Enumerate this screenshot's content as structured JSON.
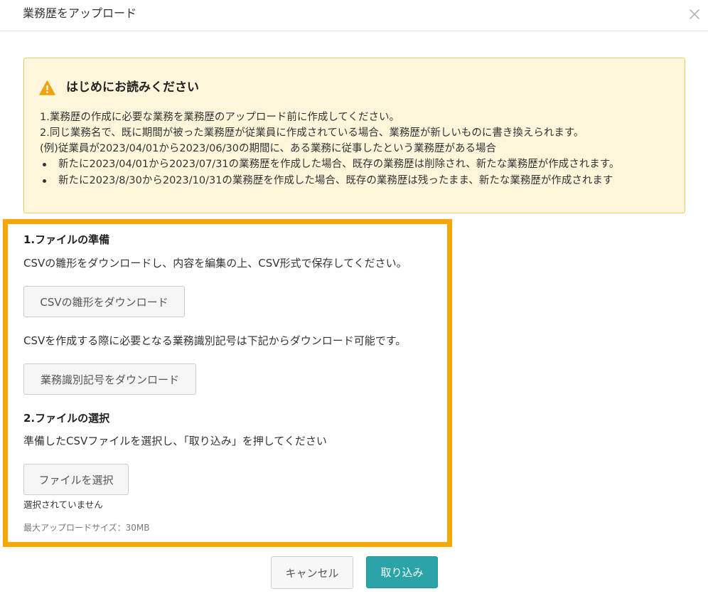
{
  "dialog": {
    "title": "業務歴をアップロード"
  },
  "notice": {
    "title": "はじめにお読みください",
    "lines": [
      "1.業務歴の作成に必要な業務を業務歴のアップロード前に作成してください。",
      "2.同じ業務名で、既に期間が被った業務歴が従業員に作成されている場合、業務歴が新しいものに書き換えられます。",
      "(例)従業員が2023/04/01から2023/06/30の期間に、ある業務に従事したという業務歴がある場合"
    ],
    "bullets": [
      "新たに2023/04/01から2023/07/31の業務歴を作成した場合、既存の業務歴は削除され、新たな業務歴が作成されます。",
      "新たに2023/8/30から2023/10/31の業務歴を作成した場合、既存の業務歴は残ったまま、新たな業務歴が作成されます"
    ]
  },
  "prepare": {
    "title": "1.ファイルの準備",
    "description": "CSVの雛形をダウンロードし、内容を編集の上、CSV形式で保存してください。",
    "template_button": "CSVの雛形をダウンロード",
    "id_description": "CSVを作成する際に必要となる業務識別記号は下記からダウンロード可能です。",
    "id_button": "業務識別記号をダウンロード"
  },
  "select": {
    "title": "2.ファイルの選択",
    "description": "準備したCSVファイルを選択し、「取り込み」を押してください",
    "file_button": "ファイルを選択",
    "file_status": "選択されていません",
    "max_size": "最大アップロードサイズ：30MB"
  },
  "footer": {
    "cancel": "キャンセル",
    "import": "取り込み"
  },
  "colors": {
    "notice_bg": "#fdf6db",
    "notice_border": "#ebcb72",
    "warning": "#f0a30a",
    "highlight": "#f5a800",
    "primary": "#2aa4a8"
  }
}
